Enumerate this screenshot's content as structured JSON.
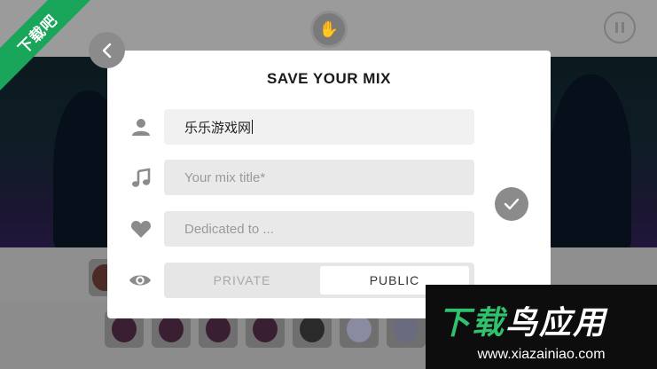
{
  "dialog": {
    "title": "SAVE YOUR MIX",
    "fields": {
      "author": {
        "value": "乐乐游戏网",
        "placeholder": ""
      },
      "mix_title": {
        "value": "",
        "placeholder": "Your mix title*"
      },
      "dedication": {
        "value": "",
        "placeholder": "Dedicated to ..."
      }
    },
    "visibility": {
      "options": [
        "PRIVATE",
        "PUBLIC"
      ],
      "selected": "PUBLIC"
    }
  },
  "icons": {
    "back": "chevron-left-icon",
    "author": "user-icon",
    "mix_title": "music-note-icon",
    "dedication": "heart-icon",
    "visibility": "eye-icon",
    "confirm": "checkmark-icon",
    "pause": "pause-icon"
  },
  "watermarks": {
    "corner_text": "下载吧",
    "banner_brand_main": "下载",
    "banner_brand_accent": "鸟应用",
    "banner_url": "www.xiazainiao.com"
  },
  "colors": {
    "modal_bg": "#ffffff",
    "field_bg": "#f1f1f1",
    "icon_grey": "#8b8b8b",
    "watermark_green": "#19a55a"
  }
}
